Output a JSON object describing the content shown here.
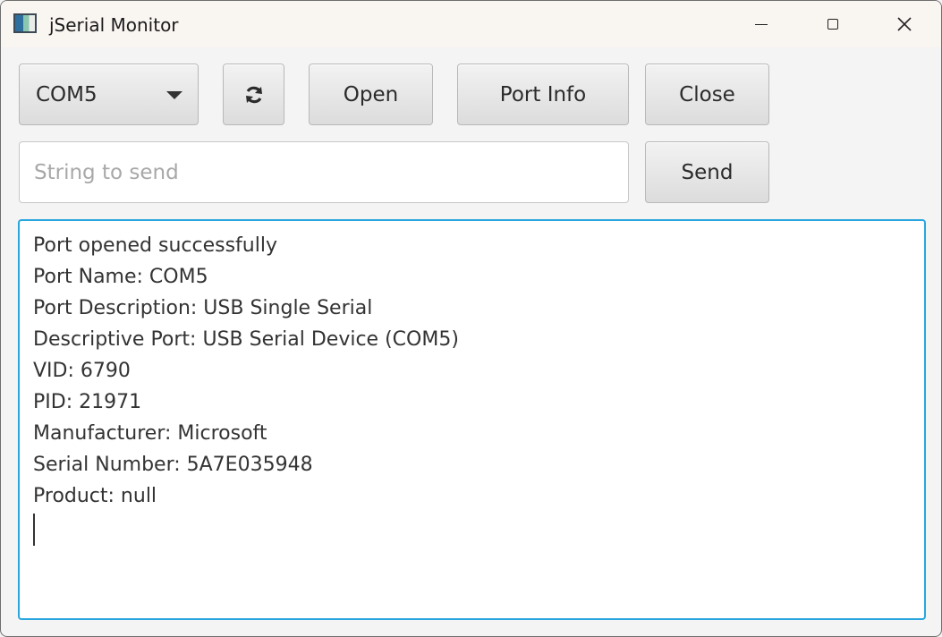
{
  "window": {
    "title": "jSerial Monitor",
    "icon": "app-icon",
    "controls": {
      "minimize": "minimize-icon",
      "maximize": "maximize-icon",
      "close": "close-icon"
    }
  },
  "toolbar": {
    "port_select": {
      "value": "COM5",
      "icon": "chevron-down-icon"
    },
    "refresh_icon": "refresh-icon",
    "open_label": "Open",
    "port_info_label": "Port Info",
    "close_label": "Close"
  },
  "send": {
    "placeholder": "String to send",
    "value": "",
    "button_label": "Send"
  },
  "output": {
    "lines": [
      "Port opened successfully",
      "Port Name: COM5",
      "Port Description: USB Single Serial",
      "Descriptive Port: USB Serial Device (COM5)",
      "VID: 6790",
      "PID: 21971",
      "Manufacturer: Microsoft",
      "Serial Number: 5A7E035948",
      "Product: null"
    ]
  },
  "colors": {
    "focus_border": "#2aa6df",
    "titlebar": "#f9f5f1",
    "window_bg": "#f4f4f4"
  }
}
